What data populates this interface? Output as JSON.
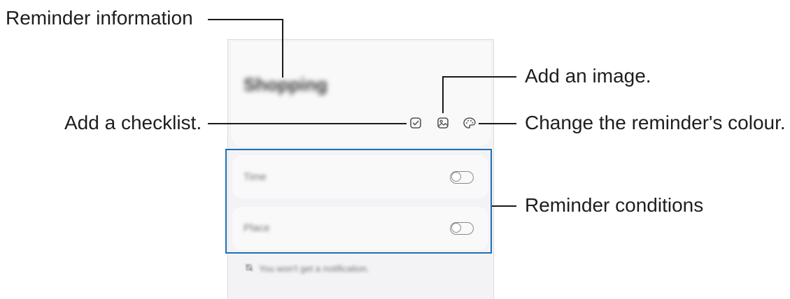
{
  "reminder": {
    "title": "Shopping",
    "conditions": [
      {
        "label": "Time",
        "enabled": false
      },
      {
        "label": "Place",
        "enabled": false
      }
    ],
    "notice": "You won't get a notification."
  },
  "icons": {
    "checklist": "checkbox-icon",
    "image": "image-icon",
    "colour": "palette-icon",
    "notice": "bell-off-icon"
  },
  "callouts": {
    "reminder_information": "Reminder information",
    "add_checklist": "Add a checklist.",
    "add_image": "Add an image.",
    "change_colour": "Change the reminder's colour.",
    "reminder_conditions": "Reminder conditions"
  },
  "colors": {
    "highlight_box": "#1f6fb5",
    "screen_bg": "#f3f3f5",
    "card_bg": "#f9f9fa"
  }
}
